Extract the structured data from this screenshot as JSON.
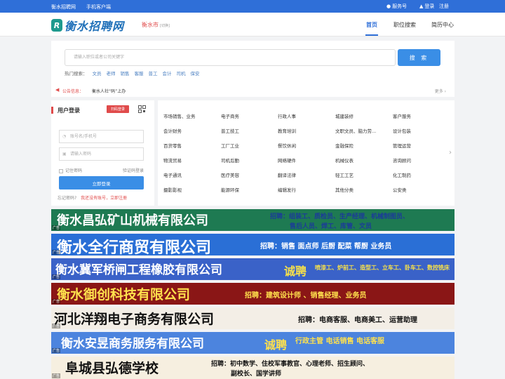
{
  "topbar": {
    "site_name": "衡水招聘网",
    "mobile": "手机客户端",
    "service": "服务号",
    "login": "登录",
    "register": "注册"
  },
  "header": {
    "logo_mark": "R",
    "logo_text": "衡水招聘网",
    "city": "衡水市",
    "city_note": "[切换]",
    "nav": [
      "首页",
      "职位搜索",
      "简历中心"
    ]
  },
  "search": {
    "placeholder": "请输入职位或者公司关键字",
    "button": "搜 索",
    "hot_label": "热门搜索：",
    "hot_keywords": [
      "文员",
      "老师",
      "销售",
      "客服",
      "普工",
      "会计",
      "司机",
      "保安"
    ]
  },
  "notice": {
    "label": "公告信息：",
    "text": "衡水人社“码”上办",
    "more": "更多 ›"
  },
  "login": {
    "title": "用户登录",
    "scan": "扫码登录",
    "account_placeholder": "账号名/手机号",
    "password_placeholder": "请输入密码",
    "remember": "记住密码",
    "sms_login": "验证码登录",
    "submit": "立即登录",
    "forgot": "忘记密码?",
    "register_prompt": "我还没有账号，立即注册"
  },
  "categories": [
    [
      "市场销售、业务",
      "电子商务",
      "行政人事",
      "城建装修",
      "客户服务"
    ],
    [
      "会计财务",
      "普工技工",
      "教育培训",
      "文职文员、脑力劳...",
      "设计包装"
    ],
    [
      "百货零售",
      "工厂工业",
      "餐饮休闲",
      "金融保险",
      "管理运营"
    ],
    [
      "物流贸易",
      "司机后勤",
      "网络硬件",
      "机械仪表",
      "咨询顾问"
    ],
    [
      "电子通讯",
      "医疗美容",
      "翻译法律",
      "轻工工艺",
      "化工制药"
    ],
    [
      "摄影影视",
      "能源环保",
      "编辑发行",
      "其他分类",
      "公安类"
    ]
  ],
  "banners": [
    {
      "company": "衡水昌弘矿山机械有限公司",
      "recruit": "招聘：组装工、质检员、生产经理、机械制图员、",
      "recruit2": "售后人员、焊工、库管、文员",
      "bg": "#1e7a52",
      "fg": "#ffffff",
      "sub_fg": "#1b3a9a"
    },
    {
      "company": "衡水全行商贸有限公司",
      "recruit": "招聘：销售 面点师 后厨 配菜 帮厨 业务员",
      "recruit2": "",
      "bg": "#2a6fd6",
      "fg": "#ffffff",
      "sub_fg": "#ffffff"
    },
    {
      "company": "衡水冀军桥闸工程橡胶有限公司",
      "recruit": "诚聘",
      "recruit2": "喷漆工、炉前工、造型工、立车工、卧车工、数控铣床",
      "bg": "#3a62c8",
      "fg": "#ffffff",
      "sub_fg": "#f7e04a"
    },
    {
      "company": "衡水御创科技有限公司",
      "recruit": "招聘：建筑设计师 、销售经理、业务员",
      "recruit2": "",
      "bg": "#8a1616",
      "fg": "#ffe14d",
      "sub_fg": "#ffe14d"
    },
    {
      "company": "河北洋翔电子商务有限公司",
      "recruit": "招聘：电商客服、电商美工、运营助理",
      "recruit2": "",
      "bg": "#f3eee6",
      "fg": "#111111",
      "sub_fg": "#111111"
    },
    {
      "company": "衡水安昱商务服务有限公司",
      "recruit": "诚聘",
      "recruit2": "行政主管 电话销售 电话客服",
      "bg": "#4c84de",
      "fg": "#ffffff",
      "sub_fg": "#ffe14d"
    },
    {
      "company": "阜城县弘德学校",
      "recruit": "招聘：初中数学、住校军事教官、心理老师、招生顾问、",
      "recruit2": "副校长、国学讲师",
      "bg": "#f6efe0",
      "fg": "#111111",
      "sub_fg": "#111111"
    }
  ],
  "ad_tag": "广告",
  "colors": {
    "primary": "#2f6fd8",
    "accent": "#e04b4b"
  }
}
